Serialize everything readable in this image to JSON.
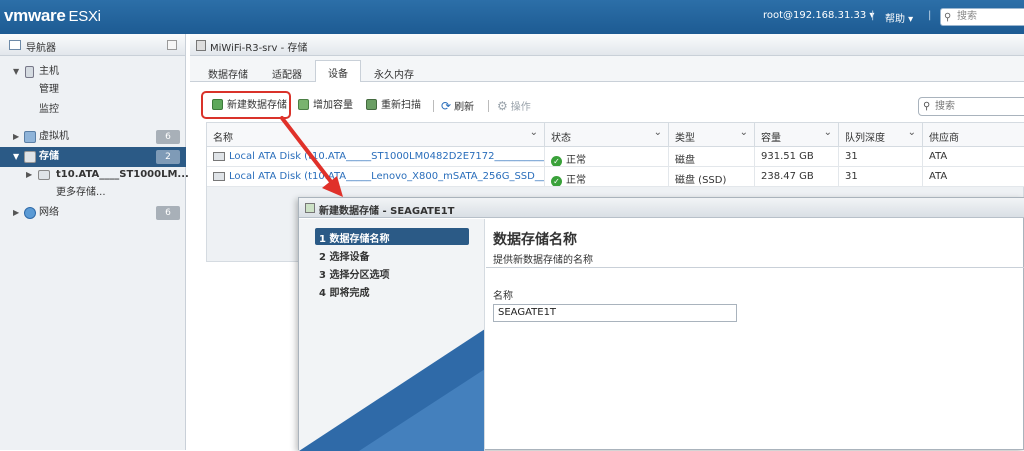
{
  "topbar": {
    "logo_brand": "vmware",
    "logo_product": "ESXi",
    "user": "root@192.168.31.33 ▾",
    "separator": "|",
    "help": "帮助 ▾",
    "search_placeholder": "搜索"
  },
  "navigator": {
    "title": "导航器",
    "host": "主机",
    "host_children": [
      "管理",
      "监控"
    ],
    "vms": {
      "label": "虚拟机",
      "count": "6"
    },
    "storage": {
      "label": "存储",
      "count": "2"
    },
    "storage_children": [
      "t10.ATA____ST1000LM...",
      "更多存储..."
    ],
    "network": {
      "label": "网络",
      "count": "6"
    }
  },
  "main": {
    "title": "MiWiFi-R3-srv - 存储",
    "tabs": [
      "数据存储",
      "适配器",
      "设备",
      "永久内存"
    ],
    "active_tab": "设备",
    "toolbar": {
      "new_datastore": "新建数据存储",
      "increase_capacity": "增加容量",
      "rescan": "重新扫描",
      "refresh": "刷新",
      "actions": "操作"
    },
    "search_placeholder": "搜索",
    "table": {
      "columns": [
        "名称",
        "状态",
        "类型",
        "容量",
        "队列深度",
        "供应商"
      ],
      "rows": [
        [
          "Local ATA Disk (t10.ATA_____ST1000LM0482D2E7172___________...",
          "正常",
          "磁盘",
          "931.51 GB",
          "31",
          "ATA"
        ],
        [
          "Local ATA Disk (t10.ATA_____Lenovo_X800_mSATA_256G_SSD____...",
          "正常",
          "磁盘 (SSD)",
          "238.47 GB",
          "31",
          "ATA"
        ]
      ]
    }
  },
  "dialog": {
    "title": "新建数据存储 - SEAGATE1T",
    "steps": [
      "1 数据存储名称",
      "2 选择设备",
      "3 选择分区选项",
      "4 即将完成"
    ],
    "heading": "数据存储名称",
    "subheading": "提供新数据存储的名称",
    "name_label": "名称",
    "name_value": "SEAGATE1T"
  },
  "colors": {
    "brand_blue": "#1d5b93",
    "selected_nav": "#2b5a86",
    "highlight_red": "#d9322a",
    "status_ok": "#3aa13a",
    "link": "#2a6ebb"
  }
}
